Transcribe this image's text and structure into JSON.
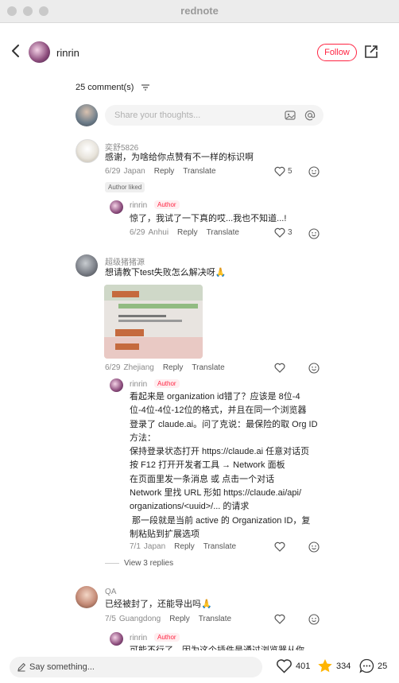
{
  "app": {
    "title": "rednote"
  },
  "header": {
    "username": "rinrin",
    "follow_label": "Follow"
  },
  "comments_header": {
    "count_label": "25 comment(s)"
  },
  "composer": {
    "placeholder": "Share your thoughts..."
  },
  "comments": [
    {
      "author": "奕舒5826",
      "text": "感谢，为啥给你点赞有不一样的标识啊",
      "date": "6/29",
      "location": "Japan",
      "reply": "Reply",
      "translate": "Translate",
      "likes": "5",
      "tag": "Author liked",
      "replies": [
        {
          "author": "rinrin",
          "badge": "Author",
          "text": "惊了，我试了一下真的哎...我也不知道...!",
          "date": "6/29",
          "location": "Anhui",
          "reply": "Reply",
          "translate": "Translate",
          "likes": "3"
        }
      ]
    },
    {
      "author": "超级猪猪源",
      "text": "想请教下test失败怎么解决呀",
      "emoji": "🙏",
      "date": "6/29",
      "location": "Zhejiang",
      "reply": "Reply",
      "translate": "Translate",
      "replies": [
        {
          "author": "rinrin",
          "badge": "Author",
          "lines": [
            "看起来是 organization id错了？应该是 8位-4",
            "位-4位-4位-12位的格式，并且在同一个浏览器",
            "登录了 claude.ai。问了克说：最保险的取 Org ID",
            "方法：",
            "保持登录状态打开 https://claude.ai 任意对话页",
            "按 F12 打开开发者工具 → Network 面板",
            "在页面里发一条消息 或 点击一个对话",
            "Network 里找 URL 形如 https://claude.ai/api/",
            "organizations/<uuid>/... 的请求",
            " 那一段就是当前 active 的 Organization ID，复",
            "制粘贴到扩展选项"
          ],
          "date": "7/1",
          "location": "Japan",
          "reply": "Reply",
          "translate": "Translate"
        }
      ],
      "view_replies": "View 3 replies"
    },
    {
      "author": "QA",
      "text": "已经被封了，还能导出吗",
      "emoji": "🙏",
      "date": "7/5",
      "location": "Guangdong",
      "reply": "Reply",
      "translate": "Translate",
      "replies": [
        {
          "author": "rinrin",
          "badge": "Author",
          "text": "可能不行了…因为这个插件是通过浏览器从你"
        }
      ]
    }
  ],
  "bottom_bar": {
    "placeholder": "Say something...",
    "likes": "401",
    "favorites": "334",
    "comments": "25"
  },
  "colors": {
    "accent": "#ff2442",
    "star": "#ffb400"
  }
}
